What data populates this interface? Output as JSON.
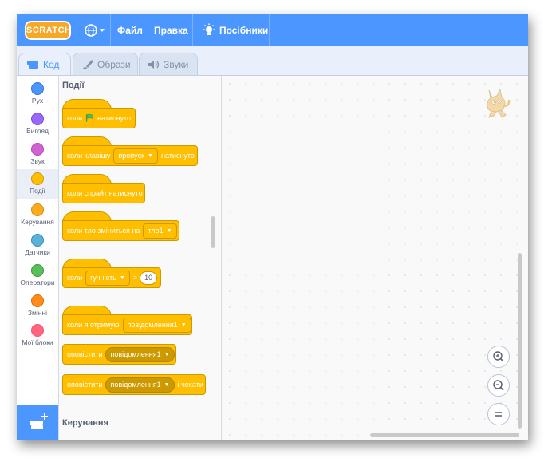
{
  "menubar": {
    "logo_text": "SCRATCH",
    "file_label": "Файл",
    "edit_label": "Правка",
    "tutorials_label": "Посібники"
  },
  "tabs": [
    {
      "label": "Код"
    },
    {
      "label": "Образи"
    },
    {
      "label": "Звуки"
    }
  ],
  "categories": [
    {
      "label": "Рух",
      "color": "#4c97ff"
    },
    {
      "label": "Вигляд",
      "color": "#9966ff"
    },
    {
      "label": "Звук",
      "color": "#cf63cf"
    },
    {
      "label": "Події",
      "color": "#ffbf00"
    },
    {
      "label": "Керування",
      "color": "#ffab19"
    },
    {
      "label": "Датчики",
      "color": "#5cb1d6"
    },
    {
      "label": "Оператори",
      "color": "#59c059"
    },
    {
      "label": "Змінні",
      "color": "#ff8c1a"
    },
    {
      "label": "Мої блоки",
      "color": "#ff6680"
    }
  ],
  "palette": {
    "section_events": "Події",
    "section_control": "Керування",
    "blocks": {
      "flag_a": "коли",
      "flag_b": "натиснуто",
      "key_a": "коли клавішу",
      "key_dd": "пропуск",
      "key_b": "натиснуто",
      "sprite_clicked": "коли спрайт натиснуто",
      "backdrop_a": "коли тло зміниться на",
      "backdrop_dd": "тло1",
      "gt_a": "коли",
      "gt_dd": "гучність",
      "gt_op": ">",
      "gt_val": "10",
      "receive_a": "коли я отримую",
      "receive_dd": "повідомлення1",
      "broadcast_a": "оповістити",
      "broadcast_dd": "повідомлення1",
      "broadcast_wait_a": "оповістити",
      "broadcast_wait_dd": "повідомлення1",
      "broadcast_wait_b": "і чекати"
    }
  },
  "colors": {
    "menubar": "#4c97ff",
    "events_block": "#ffbf00",
    "events_border": "#cc9900"
  }
}
